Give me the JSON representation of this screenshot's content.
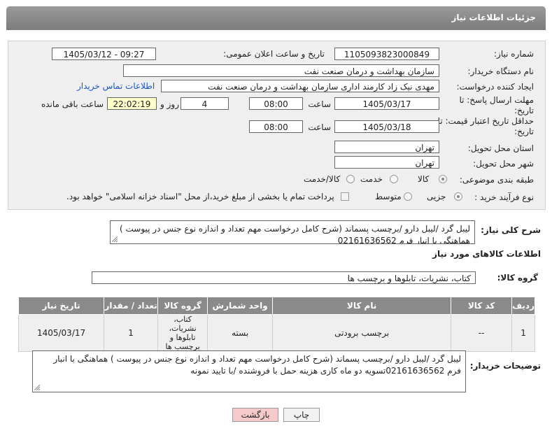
{
  "header": {
    "title": "جزئیات اطلاعات نیاز"
  },
  "form": {
    "need_number_label": "شماره نیاز:",
    "need_number": "1105093823000849",
    "announce_label": "تاریخ و ساعت اعلان عمومی:",
    "announce_value": "1405/03/12 - 09:27",
    "buyer_org_label": "نام دستگاه خریدار:",
    "buyer_org": "سازمان بهداشت و درمان صنعت نفت",
    "creator_label": "ایجاد کننده درخواست:",
    "creator": "مهدی نیک زاد کارمند اداری سازمان بهداشت و درمان صنعت نفت",
    "contact_link": "اطلاعات تماس خریدار",
    "reply_deadline_label": "مهلت ارسال پاسخ: تا تاریخ:",
    "reply_date": "1405/03/17",
    "time_label": "ساعت",
    "reply_time": "08:00",
    "days_value": "4",
    "days_label": "روز و",
    "remaining_time": "22:02:19",
    "remaining_label": "ساعت باقی مانده",
    "validity_label": "حداقل تاریخ اعتبار قیمت: تا تاریخ:",
    "validity_date": "1405/03/18",
    "validity_time": "08:00",
    "province_label": "استان محل تحویل:",
    "province": "تهران",
    "city_label": "شهر محل تحویل:",
    "city": "تهران",
    "category_label": "طبقه بندی موضوعی:",
    "category_options": [
      "کالا",
      "خدمت",
      "کالا/خدمت"
    ],
    "purchase_type_label": "نوع فرآیند خرید :",
    "purchase_options": [
      "جزیی",
      "متوسط"
    ],
    "payment_note": "پرداخت تمام یا بخشی از مبلغ خرید،از محل \"اسناد خزانه اسلامی\" خواهد بود."
  },
  "summary": {
    "label": "شرح کلی نیاز:",
    "text": "لیبل گرد /لیبل دارو /برچسب پسماند (شرح کامل درخواست مهم تعداد و اندازه نوع جنس در پیوست ) هماهنگی با انبار فرم 02161636562"
  },
  "goods_info_title": "اطلاعات کالاهای مورد نیاز",
  "goods_group": {
    "label": "گروه کالا:",
    "value": "کتاب، نشریات، تابلوها و برچسب ها"
  },
  "table": {
    "headers": [
      "ردیف",
      "کد کالا",
      "نام کالا",
      "واحد شمارش",
      "گروه کالا",
      "تعداد / مقدار",
      "تاریخ نیاز"
    ],
    "rows": [
      {
        "index": "1",
        "code": "--",
        "name": "برچسب برودتی",
        "unit": "بسته",
        "group": "کتاب، نشریات، تابلوها و برچسب ها",
        "qty": "1",
        "date": "1405/03/17"
      }
    ]
  },
  "buyer_notes": {
    "label": "توضیحات خریدار:",
    "text": "لیبل گرد /لیبل دارو /برچسب پسماند (شرح کامل درخواست مهم تعداد و اندازه نوع جنس در پیوست ) هماهنگی با انبار فرم 02161636562تسویه دو ماه کاری هزینه حمل با فروشنده /با تایید نمونه"
  },
  "buttons": {
    "print": "چاپ",
    "back": "بازگشت"
  }
}
